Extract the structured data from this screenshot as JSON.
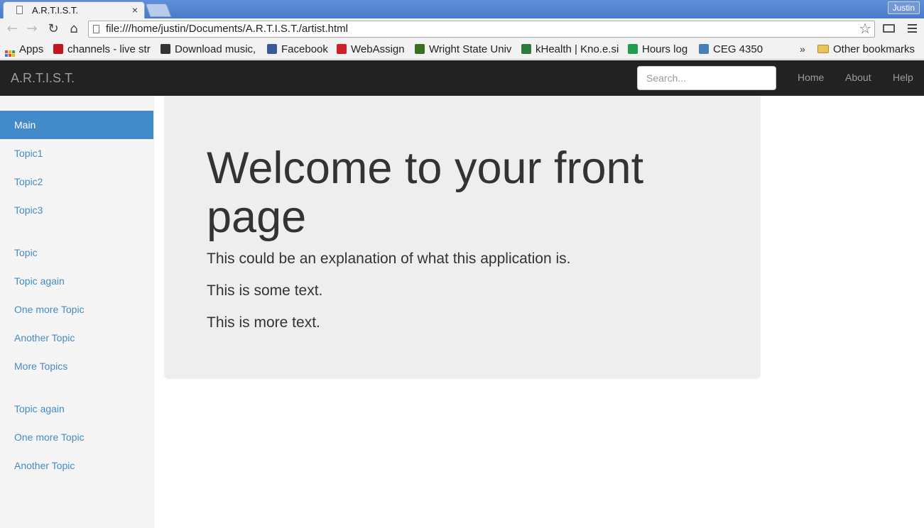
{
  "browser": {
    "tab_title": "A.R.T.I.S.T.",
    "tab_close": "×",
    "user_name": "Justin",
    "url": "file:///home/justin/Documents/A.R.T.I.S.T./artist.html",
    "bookmarks": [
      {
        "label": "Apps"
      },
      {
        "label": "channels - live str",
        "color": "#c4151c"
      },
      {
        "label": "Download music,",
        "color": "#333333"
      },
      {
        "label": "Facebook",
        "color": "#3b5998"
      },
      {
        "label": "WebAssign",
        "color": "#cc1f2a"
      },
      {
        "label": "Wright State Univ",
        "color": "#3b6e23"
      },
      {
        "label": "kHealth | Kno.e.si",
        "color": "#2f7b3c"
      },
      {
        "label": "Hours log",
        "color": "#1e9e4f"
      },
      {
        "label": "CEG 4350",
        "color": "#4a7fb5"
      }
    ],
    "bookmarks_overflow": "»",
    "other_bookmarks": "Other bookmarks"
  },
  "navbar": {
    "brand": "A.R.T.I.S.T.",
    "search_placeholder": "Search...",
    "links": [
      "Home",
      "About",
      "Help"
    ]
  },
  "sidebar": {
    "items": [
      {
        "label": "Main",
        "active": true
      },
      {
        "label": "Topic1"
      },
      {
        "label": "Topic2"
      },
      {
        "label": "Topic3"
      },
      {
        "label": "Topic"
      },
      {
        "label": "Topic again"
      },
      {
        "label": "One more Topic"
      },
      {
        "label": "Another Topic"
      },
      {
        "label": "More Topics"
      },
      {
        "label": "Topic again"
      },
      {
        "label": "One more Topic"
      },
      {
        "label": "Another Topic"
      }
    ]
  },
  "main": {
    "heading": "Welcome to your front page",
    "paragraphs": [
      "This could be an explanation of what this application is.",
      "This is some text.",
      "This is more text."
    ]
  },
  "colors": {
    "accent": "#428bca",
    "navbar_bg": "#222222",
    "jumbotron_bg": "#eeeeee"
  }
}
